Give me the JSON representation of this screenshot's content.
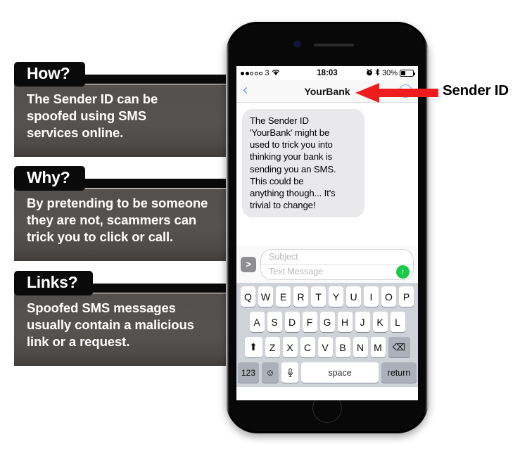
{
  "panels": [
    {
      "id": "how",
      "tab": "How?",
      "lines": [
        "The Sender ID can be",
        "spoofed using SMS",
        "services online."
      ]
    },
    {
      "id": "why",
      "tab": "Why?",
      "lines": [
        "By pretending to be someone",
        "they are not, scammers can",
        "trick you to click or call."
      ]
    },
    {
      "id": "links",
      "tab": "Links?",
      "lines": [
        "Spoofed SMS messages",
        "usually contain a malicious",
        "link or a request."
      ]
    }
  ],
  "annotation": {
    "label": "Sender ID",
    "arrow_color": "#ee1c1c"
  },
  "phone": {
    "statusbar": {
      "carrier": "3",
      "signal_filled": 2,
      "signal_total": 5,
      "wifi_icon": "wifi-icon",
      "time": "18:03",
      "alarm_icon": "alarm-clock-icon",
      "bluetooth_icon": "bluetooth-icon",
      "battery_percent": "30%",
      "battery_level": 30
    },
    "navbar": {
      "back_icon": "chevron-left-icon",
      "title": "YourBank",
      "contact_icon": "contact-circle-icon"
    },
    "conversation": {
      "bubble_lines": [
        "The Sender ID",
        "'YourBank' might be",
        "used to trick you into",
        "thinking your bank is",
        "sending you an SMS.",
        "This could be",
        "anything though... It's",
        "trivial to change!"
      ]
    },
    "compose": {
      "expand_icon": ">",
      "subject_placeholder": "Subject",
      "message_placeholder": "Text Message",
      "send_icon": "↑"
    },
    "keyboard": {
      "row1": [
        "Q",
        "W",
        "E",
        "R",
        "T",
        "Y",
        "U",
        "I",
        "O",
        "P"
      ],
      "row2": [
        "A",
        "S",
        "D",
        "F",
        "G",
        "H",
        "J",
        "K",
        "L"
      ],
      "row3": [
        "Z",
        "X",
        "C",
        "V",
        "B",
        "N",
        "M"
      ],
      "shift_icon": "⬆",
      "backspace_icon": "⌫",
      "numbers_key": "123",
      "emoji_icon": "☺",
      "mic_icon": "mic-icon",
      "space_key": "space",
      "return_key": "return"
    }
  }
}
